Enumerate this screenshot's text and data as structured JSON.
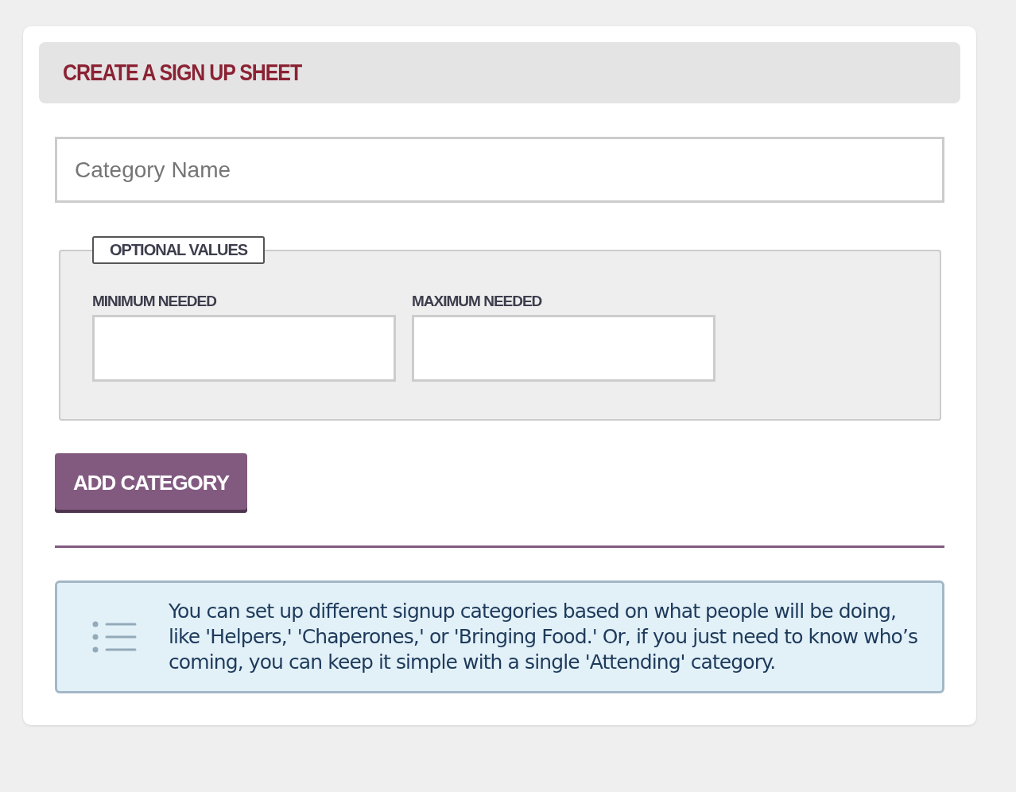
{
  "header": {
    "title": "CREATE A SIGN UP SHEET"
  },
  "category_name": {
    "placeholder": "Category Name"
  },
  "optional_values": {
    "legend": "OPTIONAL VALUES",
    "fields": [
      {
        "label": "MINIMUM NEEDED"
      },
      {
        "label": "MAXIMUM NEEDED"
      }
    ]
  },
  "add_button": {
    "label": "ADD CATEGORY"
  },
  "info": {
    "text": "You can set up different signup categories based on what people will be doing, like 'Helpers,' 'Chaperones,' or 'Bringing Food.' Or, if you just need to know who’s coming, you can keep it simple with a single 'Attending' category."
  }
}
